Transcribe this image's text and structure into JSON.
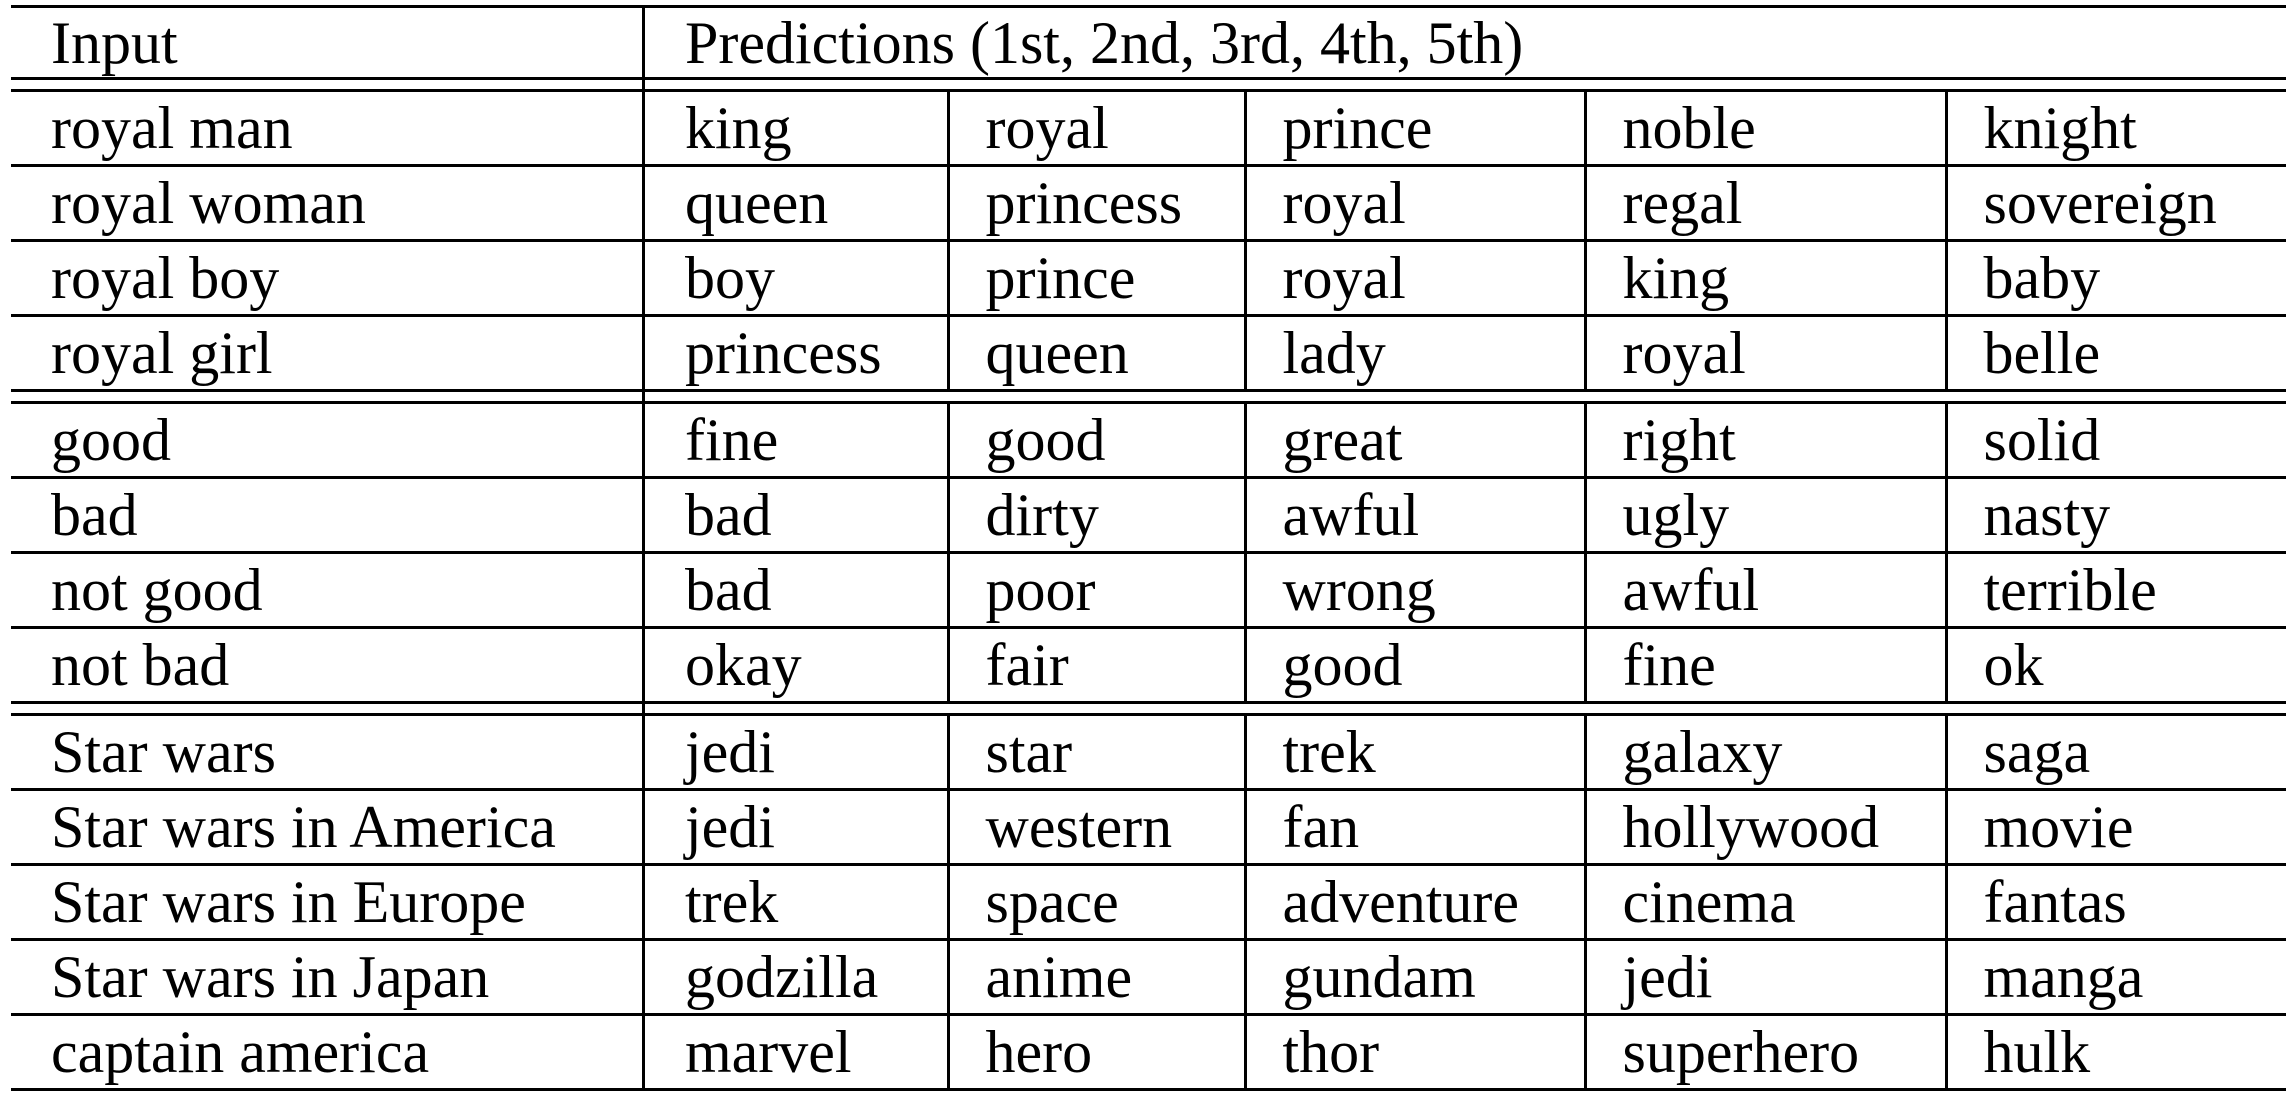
{
  "header": {
    "input_label": "Input",
    "predictions_label": "Predictions (1st, 2nd, 3rd, 4th, 5th)"
  },
  "groups": [
    {
      "rows": [
        {
          "input": "royal man",
          "preds": [
            "king",
            "royal",
            "prince",
            "noble",
            "knight"
          ]
        },
        {
          "input": "royal woman",
          "preds": [
            "queen",
            "princess",
            "royal",
            "regal",
            "sovereign"
          ]
        },
        {
          "input": "royal boy",
          "preds": [
            "boy",
            "prince",
            "royal",
            "king",
            "baby"
          ]
        },
        {
          "input": "royal girl",
          "preds": [
            "princess",
            "queen",
            "lady",
            "royal",
            "belle"
          ]
        }
      ]
    },
    {
      "rows": [
        {
          "input": "good",
          "preds": [
            "fine",
            "good",
            "great",
            "right",
            "solid"
          ]
        },
        {
          "input": "bad",
          "preds": [
            "bad",
            "dirty",
            "awful",
            "ugly",
            "nasty"
          ]
        },
        {
          "input": "not good",
          "preds": [
            "bad",
            "poor",
            "wrong",
            "awful",
            "terrible"
          ]
        },
        {
          "input": "not bad",
          "preds": [
            "okay",
            "fair",
            "good",
            "fine",
            "ok"
          ]
        }
      ]
    },
    {
      "rows": [
        {
          "input": "Star wars",
          "preds": [
            "jedi",
            "star",
            "trek",
            "galaxy",
            "saga"
          ]
        },
        {
          "input": "Star wars in America",
          "preds": [
            "jedi",
            "western",
            "fan",
            "hollywood",
            "movie"
          ]
        },
        {
          "input": "Star wars in Europe",
          "preds": [
            "trek",
            "space",
            "adventure",
            "cinema",
            "fantas"
          ]
        },
        {
          "input": "Star wars in Japan",
          "preds": [
            "godzilla",
            "anime",
            "gundam",
            "jedi",
            "manga"
          ]
        },
        {
          "input": "captain america",
          "preds": [
            "marvel",
            "hero",
            "thor",
            "superhero",
            "hulk"
          ]
        }
      ]
    }
  ]
}
